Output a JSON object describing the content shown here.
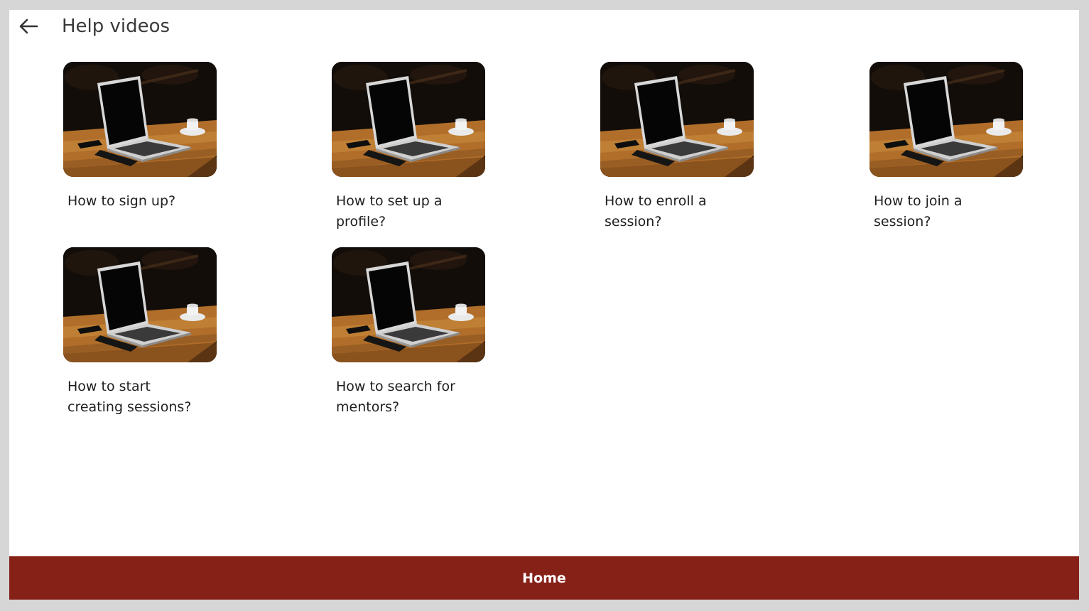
{
  "header": {
    "title": "Help videos",
    "back_icon": "arrow-left-icon"
  },
  "videos": [
    {
      "label": "How to sign up?",
      "thumbnail": "laptop-on-desk-thumbnail"
    },
    {
      "label": "How to set up a profile?",
      "thumbnail": "laptop-on-desk-thumbnail"
    },
    {
      "label": "How to enroll a session?",
      "thumbnail": "laptop-on-desk-thumbnail"
    },
    {
      "label": "How to join a session?",
      "thumbnail": "laptop-on-desk-thumbnail"
    },
    {
      "label": "How to start creating sessions?",
      "thumbnail": "laptop-on-desk-thumbnail"
    },
    {
      "label": "How to search for mentors?",
      "thumbnail": "laptop-on-desk-thumbnail"
    }
  ],
  "footer": {
    "home_label": "Home"
  },
  "colors": {
    "accent": "#862118",
    "background": "#ffffff",
    "outer_border": "#d6d6d6"
  }
}
